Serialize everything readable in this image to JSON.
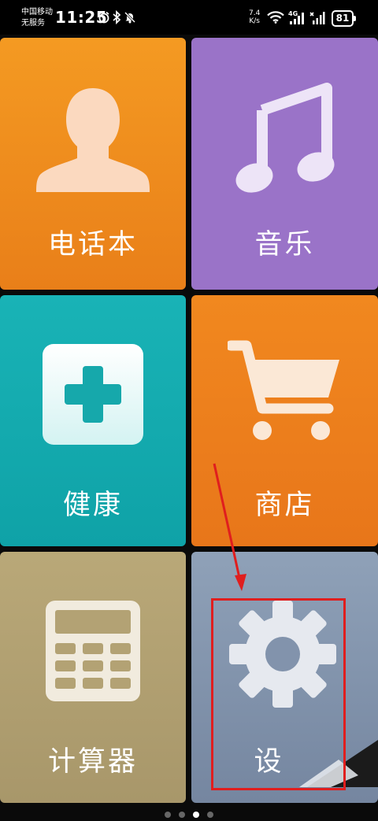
{
  "status_bar": {
    "carrier_line1": "中国移动",
    "carrier_line2": "无服务",
    "time": "11:25",
    "net_speed_value": "7.4",
    "net_speed_unit": "K/s",
    "network": "4G",
    "battery": "81"
  },
  "tiles": [
    {
      "label": "电话本",
      "icon": "person-icon",
      "color": "#f08e1f"
    },
    {
      "label": "音乐",
      "icon": "music-note-icon",
      "color": "#9a73c8"
    },
    {
      "label": "健康",
      "icon": "health-plus-icon",
      "color": "#15aaae"
    },
    {
      "label": "商店",
      "icon": "shopping-cart-icon",
      "color": "#ee811d"
    },
    {
      "label": "计算器",
      "icon": "calculator-icon",
      "color": "#b1a071"
    },
    {
      "label": "设",
      "icon": "gear-icon",
      "color": "#8293ac"
    }
  ],
  "pager": {
    "pages": 4,
    "current": 3
  },
  "annotation": {
    "highlight_color": "#e01e1e"
  }
}
